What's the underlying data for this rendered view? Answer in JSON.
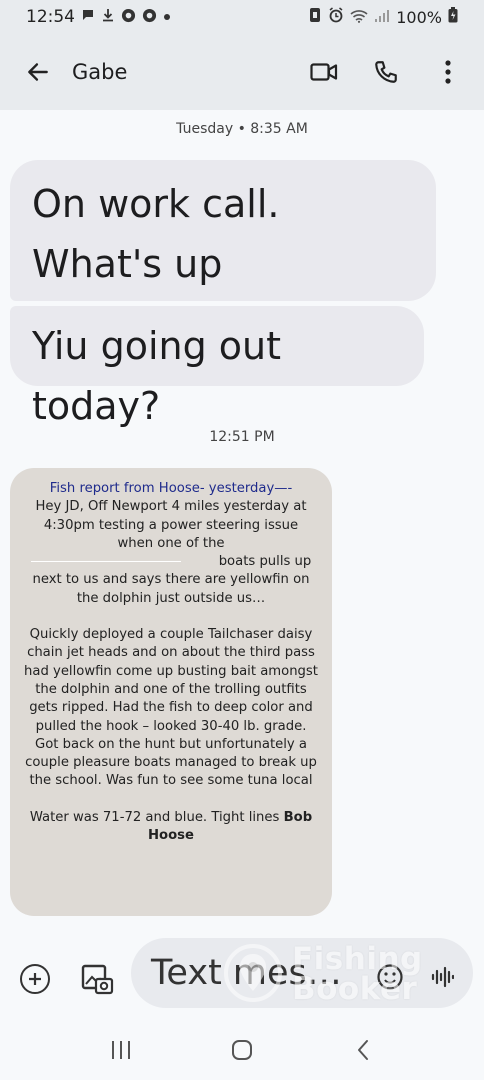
{
  "status_bar": {
    "time": "12:54",
    "battery": "100%",
    "left_icons": [
      "chat-bubble-icon",
      "download-icon",
      "chrome-icon",
      "chrome-icon",
      "dot-icon"
    ],
    "right_icons": [
      "nfc-icon",
      "alarm-icon",
      "wifi-icon",
      "signal-icon",
      "battery-icon"
    ]
  },
  "header": {
    "contact_name": "Gabe",
    "icons": [
      "back-arrow-icon",
      "video-call-icon",
      "phone-icon",
      "more-vert-icon"
    ]
  },
  "conversation": {
    "timestamp_1": "Tuesday • 8:35 AM",
    "msg_1": "On work call. What's up",
    "msg_2": "Yiu going out today?",
    "timestamp_2": "12:51 PM",
    "report": {
      "title": "Fish report from Hoose-  yesterday—-",
      "line_intro": "Hey JD, Off Newport 4 miles yesterday at 4:30pm testing a power steering issue when one of the",
      "line_boats": "boats pulls up next to us and says there are yellowfin on the dolphin just outside us…",
      "para_2": "Quickly deployed a couple Tailchaser daisy chain jet heads and on about the third pass had yellowfin come up busting bait amongst the dolphin and one of the trolling outfits gets ripped.  Had the fish to deep color and pulled the hook – looked 30-40 lb. grade.  Got back on the hunt but unfortunately a couple pleasure boats managed to break up the school.   Was fun to see some tuna local",
      "para_3": "Water was 71-72 and blue.  Tight lines",
      "signature": "Bob Hoose"
    }
  },
  "composer": {
    "placeholder": "Text mes…",
    "icons": [
      "add-icon",
      "gallery-icon",
      "emoji-icon",
      "voice-icon"
    ]
  },
  "watermark": {
    "line_1": "Fishing",
    "line_2": "Booker"
  },
  "nav": {
    "icons": [
      "recents-icon",
      "home-icon",
      "back-icon"
    ]
  }
}
